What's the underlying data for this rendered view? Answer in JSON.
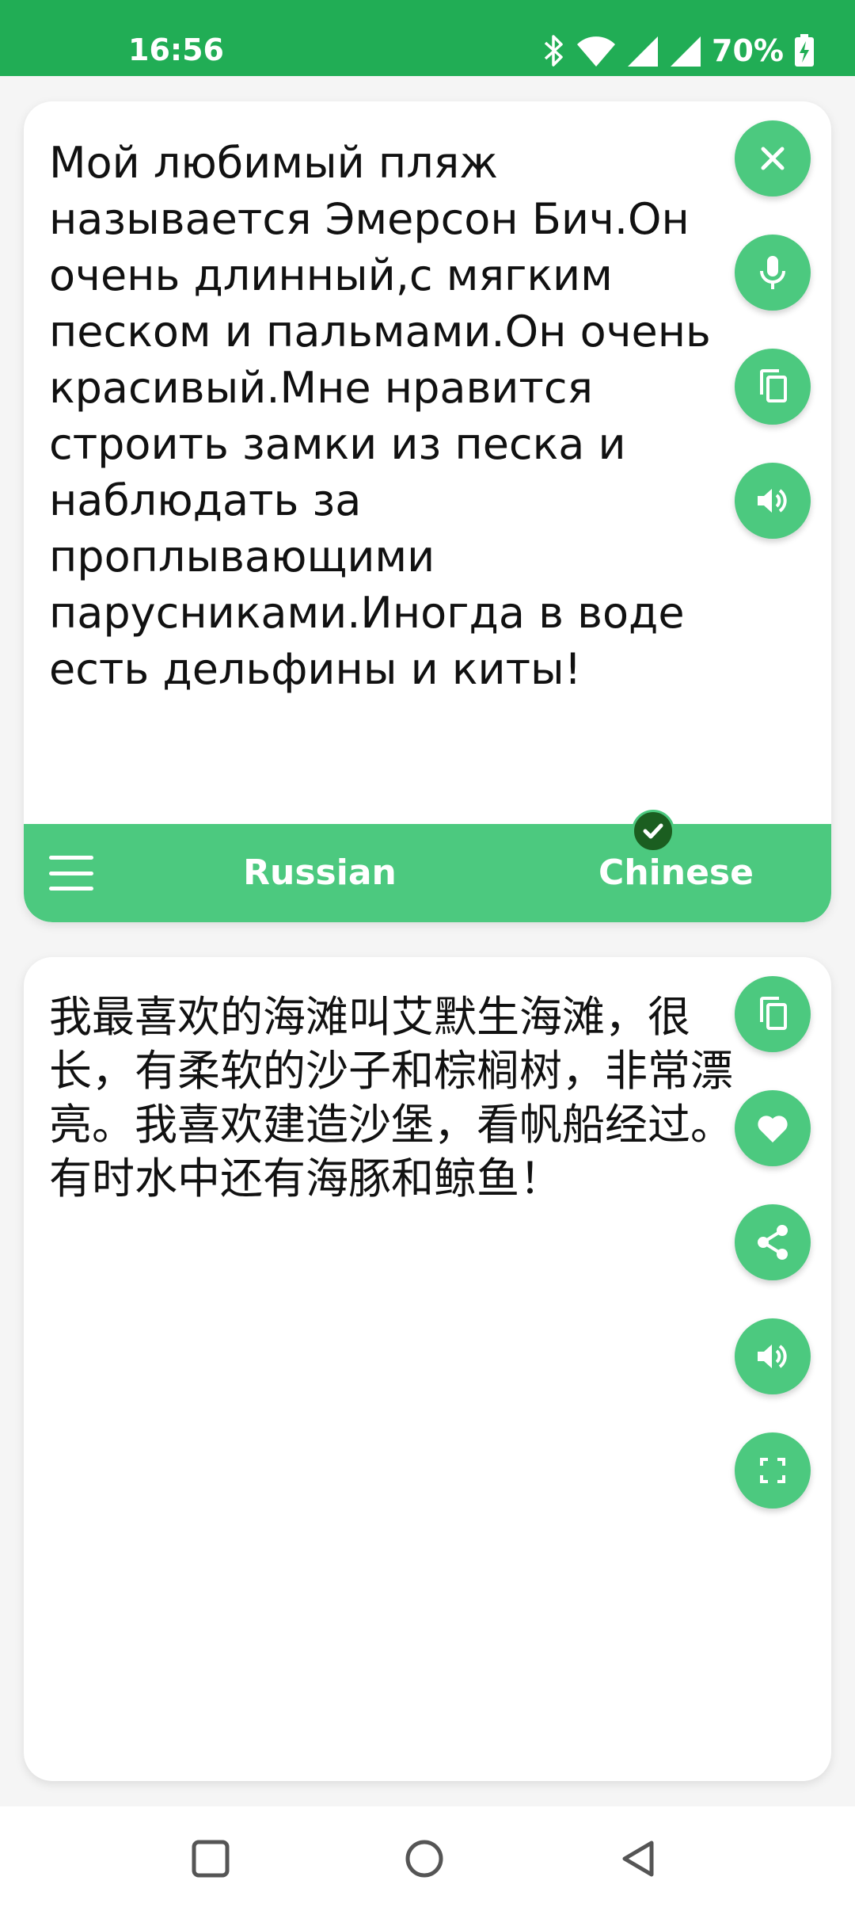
{
  "status_bar": {
    "time": "16:56",
    "battery_percent": "70%",
    "icons": [
      "bluetooth-icon",
      "wifi-icon",
      "signal-icon",
      "signal-icon",
      "battery-charging-icon"
    ]
  },
  "source": {
    "text": "Мой любимый пляж называется Эмерсон Бич.Он очень длинный,с мягким песком и пальмами.Он очень красивый.Мне нравится строить замки из песка и наблюдать за проплывающими парусниками.Иногда в воде есть дельфины и киты!",
    "actions": [
      "close-icon",
      "microphone-icon",
      "copy-icon",
      "speaker-icon"
    ]
  },
  "language_bar": {
    "menu_icon": "hamburger-menu-icon",
    "source_language": "Russian",
    "target_language": "Chinese",
    "selected_badge_icon": "check-circle-icon"
  },
  "target": {
    "text": "我最喜欢的海滩叫艾默生海滩，很长，有柔软的沙子和棕榈树，非常漂亮。我喜欢建造沙堡，看帆船经过。有时水中还有海豚和鲸鱼！",
    "actions": [
      "copy-icon",
      "heart-icon",
      "share-icon",
      "speaker-icon",
      "fullscreen-icon"
    ]
  },
  "navigation_bar": {
    "buttons": [
      "recents-square-icon",
      "home-circle-icon",
      "back-triangle-icon"
    ]
  },
  "colors": {
    "status_bar": "#21ad55",
    "accent": "#4cc97f",
    "badge": "#1b5e20",
    "background": "#f5f5f5"
  }
}
